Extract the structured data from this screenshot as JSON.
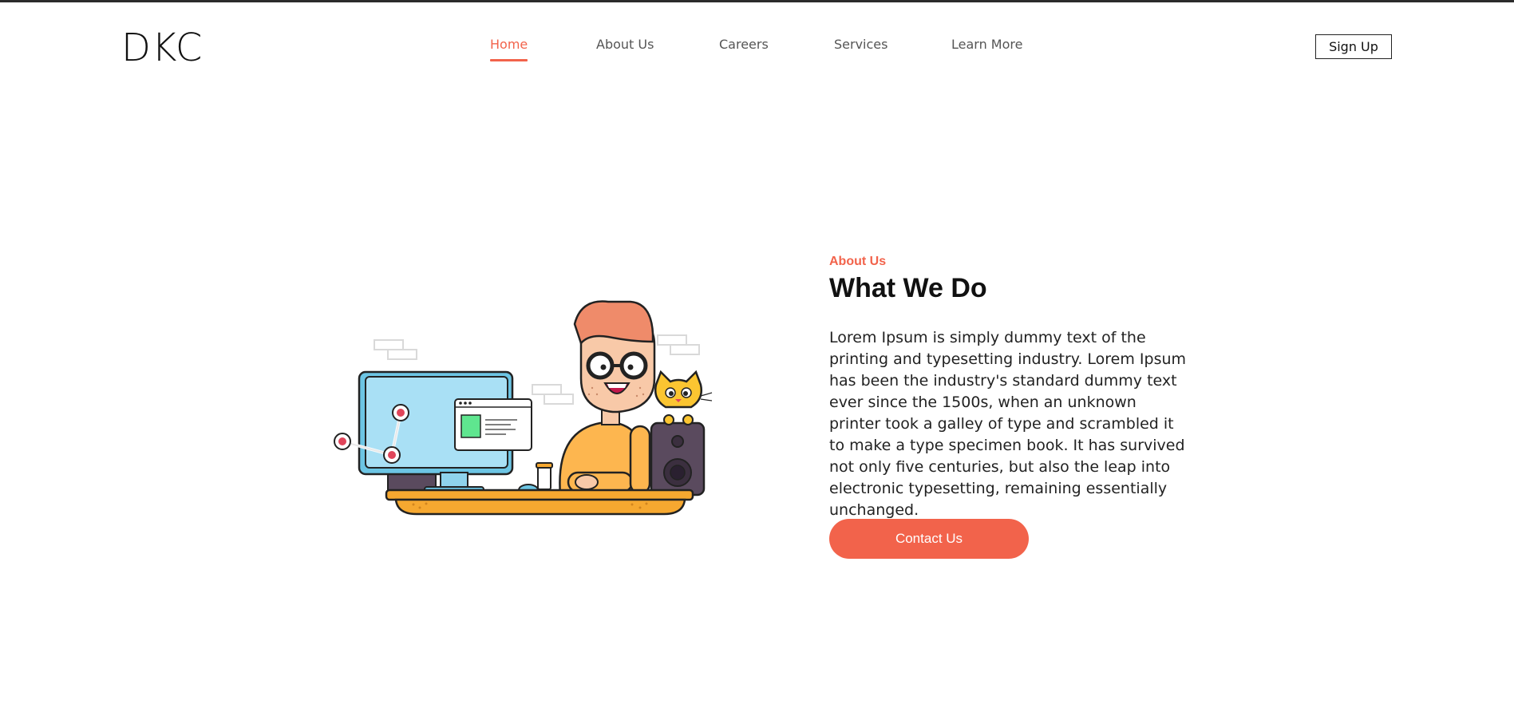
{
  "brand": {
    "logo": "DKC"
  },
  "nav": {
    "items": [
      {
        "label": "Home",
        "active": true
      },
      {
        "label": "About Us",
        "active": false
      },
      {
        "label": "Careers",
        "active": false
      },
      {
        "label": "Services",
        "active": false
      },
      {
        "label": "Learn More",
        "active": false
      }
    ],
    "signup_label": "Sign Up"
  },
  "about": {
    "eyebrow": "About Us",
    "title": "What We Do",
    "body": "Lorem Ipsum is simply dummy text of the printing and typesetting industry. Lorem Ipsum has been the industry's standard dummy text ever since the 1500s, when an unknown printer took a galley of type and scrambled it to make a type specimen book. It has survived not only five centuries, but also the leap into electronic typesetting, remaining essentially unchanged.",
    "cta_label": "Contact Us",
    "illustration_icon": "developer-at-desk-illustration"
  },
  "colors": {
    "accent": "#f2634b",
    "text": "#111111",
    "nav_text": "#555555",
    "desk": "#f6a830",
    "shirt": "#fdb64f",
    "monitor": "#a9e0f5"
  }
}
